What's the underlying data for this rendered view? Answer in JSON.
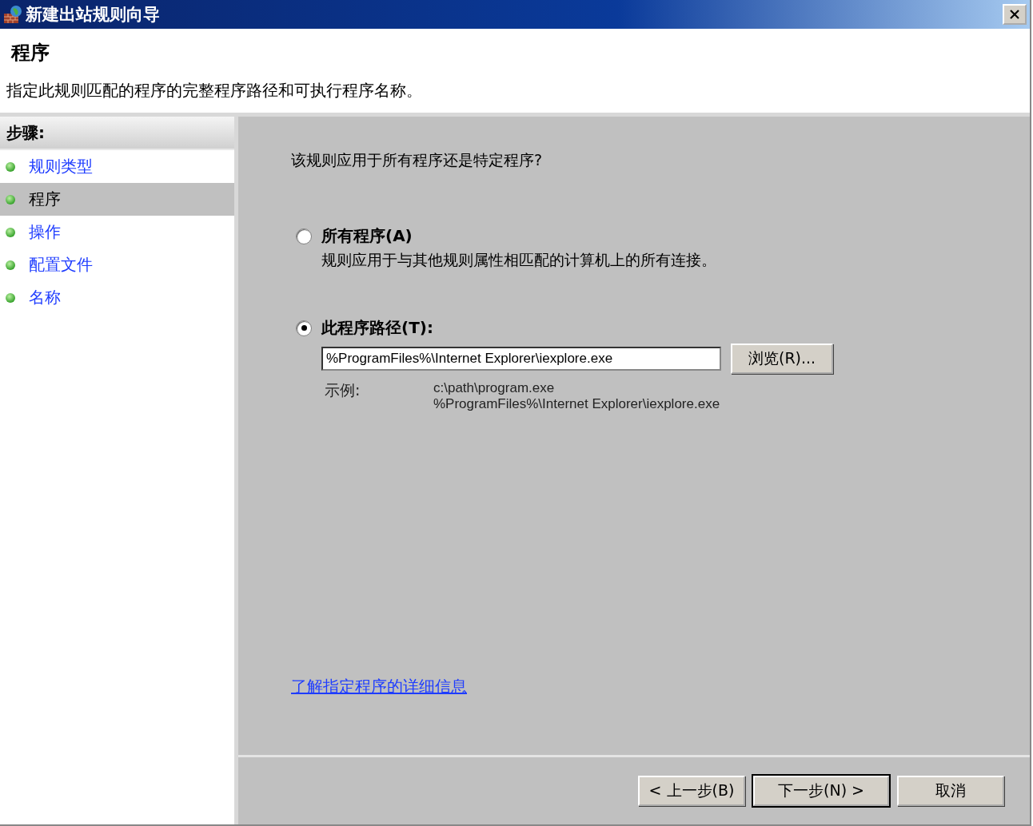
{
  "window": {
    "title": "新建出站规则向导"
  },
  "header": {
    "title": "程序",
    "description": "指定此规则匹配的程序的完整程序路径和可执行程序名称。"
  },
  "steps": {
    "heading": "步骤:",
    "items": [
      {
        "label": "规则类型",
        "selected": false
      },
      {
        "label": "程序",
        "selected": true
      },
      {
        "label": "操作",
        "selected": false
      },
      {
        "label": "配置文件",
        "selected": false
      },
      {
        "label": "名称",
        "selected": false
      }
    ]
  },
  "question": "该规则应用于所有程序还是特定程序?",
  "options": [
    {
      "label": "所有程序(A)",
      "description": "规则应用于与其他规则属性相匹配的计算机上的所有连接。",
      "selected": false
    },
    {
      "label": "此程序路径(T):",
      "selected": true
    }
  ],
  "path_field": {
    "value": "%ProgramFiles%\\Internet Explorer\\iexplore.exe"
  },
  "browse_button": "浏览(R)...",
  "example": {
    "label": "示例:",
    "lines": [
      "c:\\path\\program.exe",
      "%ProgramFiles%\\Internet Explorer\\iexplore.exe"
    ]
  },
  "help_link": "了解指定程序的详细信息",
  "buttons": [
    {
      "label": "< 上一步(B)",
      "default": false
    },
    {
      "label": "下一步(N) >",
      "default": true
    },
    {
      "label": "取消",
      "default": false
    }
  ]
}
